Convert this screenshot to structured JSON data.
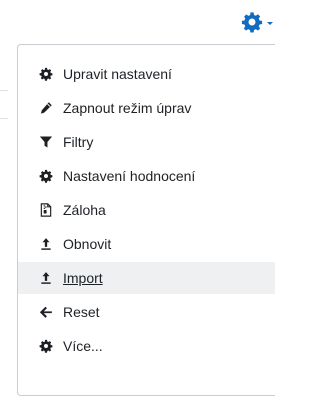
{
  "toggle": {
    "icon": "gear-icon",
    "caret_icon": "caret-down-icon",
    "accent": "#0f6cbf"
  },
  "menu": {
    "hover_index": 6,
    "items": [
      {
        "label": "Upravit nastavení",
        "icon": "gear-icon"
      },
      {
        "label": "Zapnout režim úprav",
        "icon": "pencil-icon"
      },
      {
        "label": "Filtry",
        "icon": "filter-icon"
      },
      {
        "label": "Nastavení hodnocení",
        "icon": "gear-icon"
      },
      {
        "label": "Záloha",
        "icon": "file-archive-icon"
      },
      {
        "label": "Obnovit",
        "icon": "upload-icon"
      },
      {
        "label": "Import",
        "icon": "upload-icon"
      },
      {
        "label": "Reset",
        "icon": "arrow-left-icon"
      },
      {
        "label": "Více...",
        "icon": "gear-icon"
      }
    ]
  }
}
